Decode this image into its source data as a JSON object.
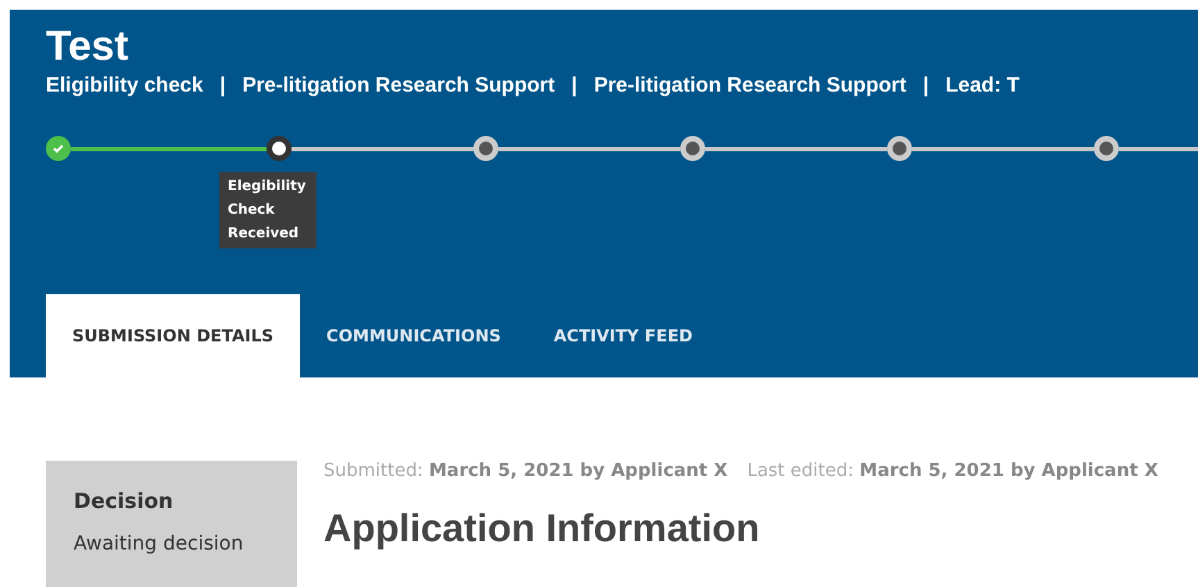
{
  "header": {
    "title": "Test",
    "subtitle": [
      "Eligibility check",
      "Pre-litigation Research Support",
      "Pre-litigation Research Support",
      "Lead: T"
    ],
    "separator": "|"
  },
  "progress": {
    "steps": [
      {
        "kind": "done"
      },
      {
        "kind": "current",
        "tooltip": "Elegibility Check Received"
      },
      {
        "kind": "pending"
      },
      {
        "kind": "pending"
      },
      {
        "kind": "pending"
      },
      {
        "kind": "pending"
      }
    ]
  },
  "tabs": [
    {
      "label": "SUBMISSION DETAILS",
      "selected": true
    },
    {
      "label": "COMMUNICATIONS",
      "selected": false
    },
    {
      "label": "ACTIVITY FEED",
      "selected": false
    }
  ],
  "sidebar": {
    "heading": "Decision",
    "status": "Awaiting decision"
  },
  "meta": [
    "Submitted: **March 5, 2021 by Applicant X**",
    "Last edited: **March 5, 2021 by Applicant X**"
  ],
  "heading": "Application Information"
}
